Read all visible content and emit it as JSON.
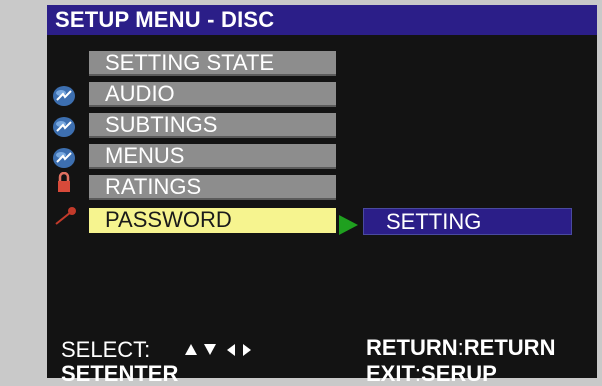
{
  "header": {
    "title": "SETUP MENU - DISC"
  },
  "menu": {
    "items": [
      {
        "label": "SETTING STATE",
        "icon": "none"
      },
      {
        "label": "AUDIO",
        "icon": "disc-icon"
      },
      {
        "label": "SUBTINGS",
        "icon": "disc-icon"
      },
      {
        "label": "MENUS",
        "icon": "disc-icon"
      },
      {
        "label": "RATINGS",
        "icon": "lock-icon"
      },
      {
        "label": "PASSWORD",
        "icon": "key-icon",
        "selected": true
      }
    ]
  },
  "submenu": {
    "label": "SETTING"
  },
  "footer": {
    "select_label": "SELECT:",
    "enter_label": "SETENTER",
    "return_key": "RETURN",
    "return_sep": ":",
    "return_action": "RETURN",
    "exit_key": "EXIT",
    "exit_sep": ":",
    "exit_action": "SERUP"
  },
  "colors": {
    "header_bg": "#2b1e88",
    "item_bg": "#8d8d8d",
    "selected_bg": "#f6f48f",
    "pointer": "#1fa01f"
  }
}
